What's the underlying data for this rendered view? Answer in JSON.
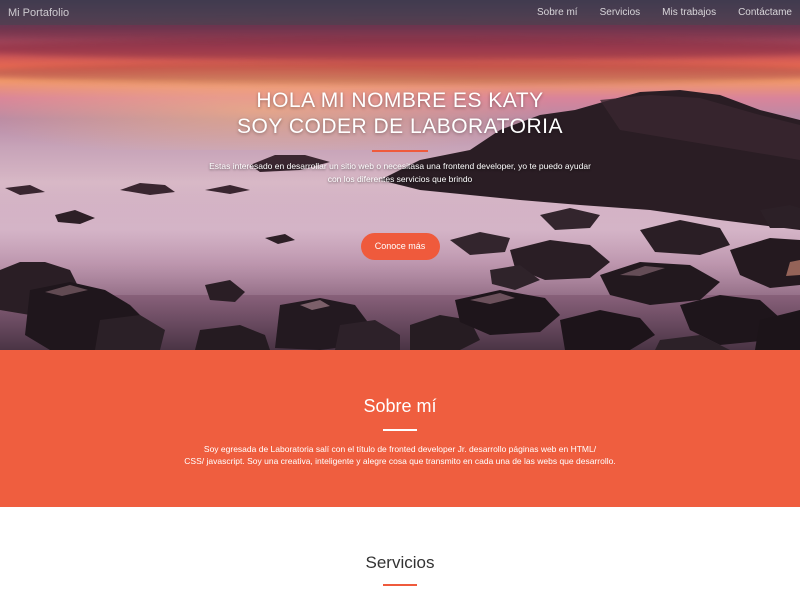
{
  "navbar": {
    "brand": "Mi Portafolio",
    "links": [
      "Sobre mí",
      "Servicios",
      "Mis trabajos",
      "Contáctame"
    ]
  },
  "hero": {
    "title_line1": "HOLA MI NOMBRE ES KATY",
    "title_line2": "SOY CODER DE LABORATORIA",
    "text_line1": "Estas interesado en desarrollar un sitio web o necesitasa una frontend developer, yo te puedo ayudar",
    "text_line2": "con los diferentes servicios que brindo",
    "button_label": "Conoce más"
  },
  "about": {
    "title": "Sobre mí",
    "text_line1": "Soy egresada de Laboratoria salí con el título de fronted developer Jr. desarrollo páginas web en HTML/",
    "text_line2": "CSS/ javascript. Soy una creativa, inteligente y alegre cosa que transmito en cada una de las webs que desarrollo."
  },
  "services": {
    "title": "Servicios"
  },
  "colors": {
    "accent": "#ef5a3c",
    "about_bg": "#ef5e3f",
    "navbar_bg": "rgba(70,70,80,0.55)"
  }
}
